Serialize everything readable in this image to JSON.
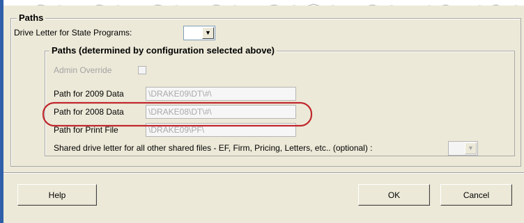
{
  "colors": {
    "dialog_bg": "#ece9d8",
    "highlight": "#c0272d",
    "window_edge": "#2f5fa8"
  },
  "paths_group": {
    "title": "Paths",
    "drive_letter_label": "Drive Letter for State Programs:",
    "drive_letter_value": "",
    "sub_group": {
      "title": "Paths (determined by configuration selected above)",
      "admin_override_label": "Admin Override",
      "admin_override_checked": false,
      "rows": [
        {
          "label": "Path for 2009 Data",
          "value": "\\DRAKE09\\DT\\#\\"
        },
        {
          "label": "Path for 2008 Data",
          "value": "\\DRAKE08\\DT\\#\\"
        },
        {
          "label": "Path  for  Print File",
          "value": "\\DRAKE09\\PF\\"
        }
      ],
      "shared_drive_label": "Shared drive letter for all other shared files - EF, Firm, Pricing, Letters, etc.. (optional) :",
      "shared_drive_value": ""
    }
  },
  "buttons": {
    "help": "Help",
    "ok": "OK",
    "cancel": "Cancel"
  },
  "icons": {
    "dropdown": "chevron-down-icon"
  }
}
